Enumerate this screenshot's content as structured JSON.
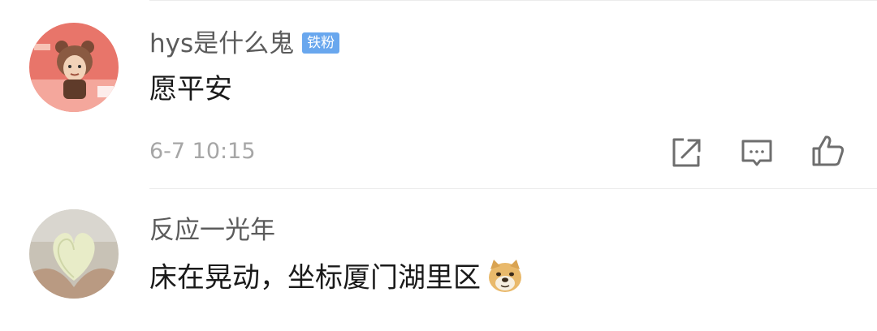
{
  "comments": [
    {
      "username": "hys是什么鬼",
      "badge": "铁粉",
      "text": "愿平安",
      "time": "6-7 10:15"
    },
    {
      "username": "反应一光年",
      "text": "床在晃动，坐标厦门湖里区",
      "emoji": "doge-emoji"
    }
  ],
  "actions": [
    "share-icon",
    "reply-icon",
    "like-icon"
  ],
  "colors": {
    "username": "#5b5b5b",
    "text": "#1a1a1a",
    "time": "#a6a6a6",
    "badge": "#69a7ee",
    "icon": "#6e6e6e"
  }
}
